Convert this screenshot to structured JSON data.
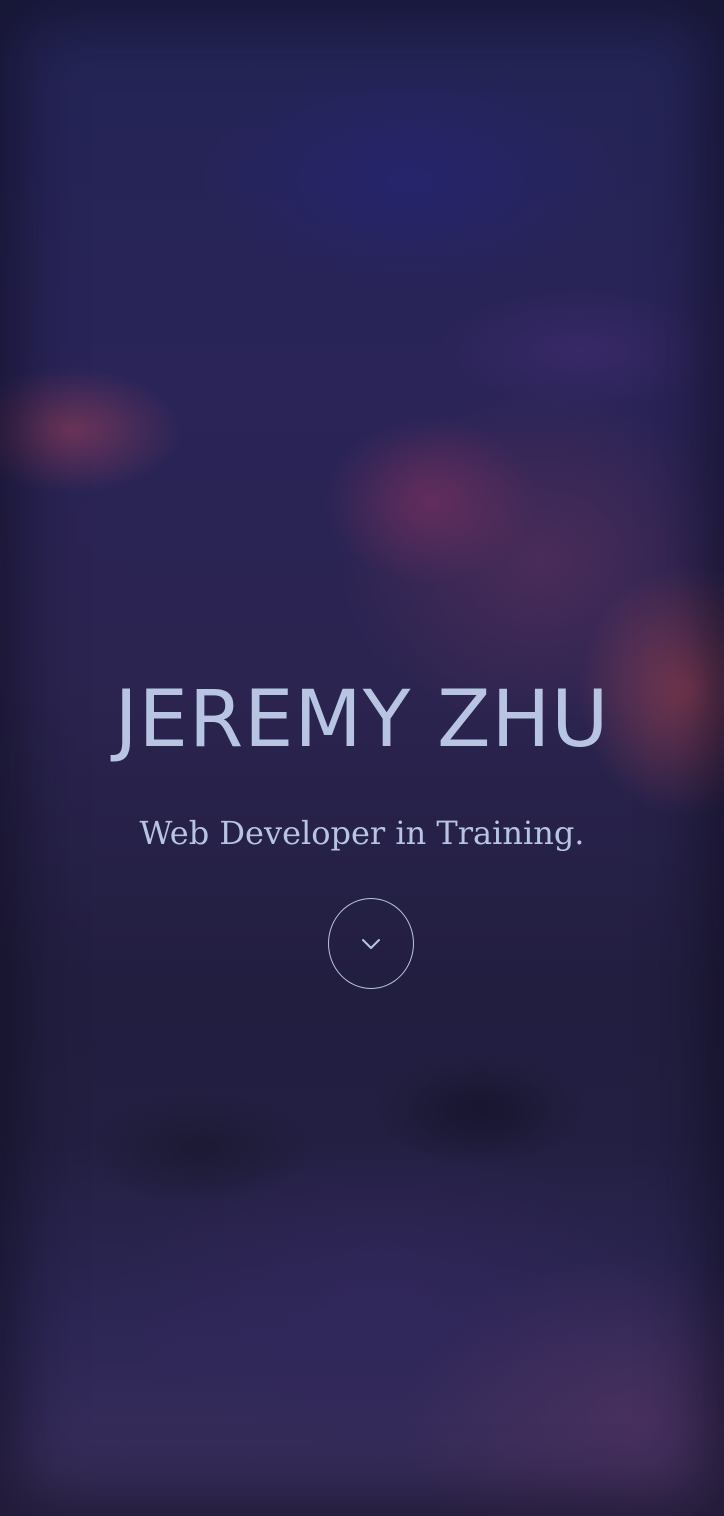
{
  "hero": {
    "name": "JEREMY ZHU",
    "tagline": "Web Developer in Training.",
    "scroll_icon": "chevron-down-icon"
  },
  "colors": {
    "text": "#b7c5e3",
    "background_base": "#211f3f"
  }
}
